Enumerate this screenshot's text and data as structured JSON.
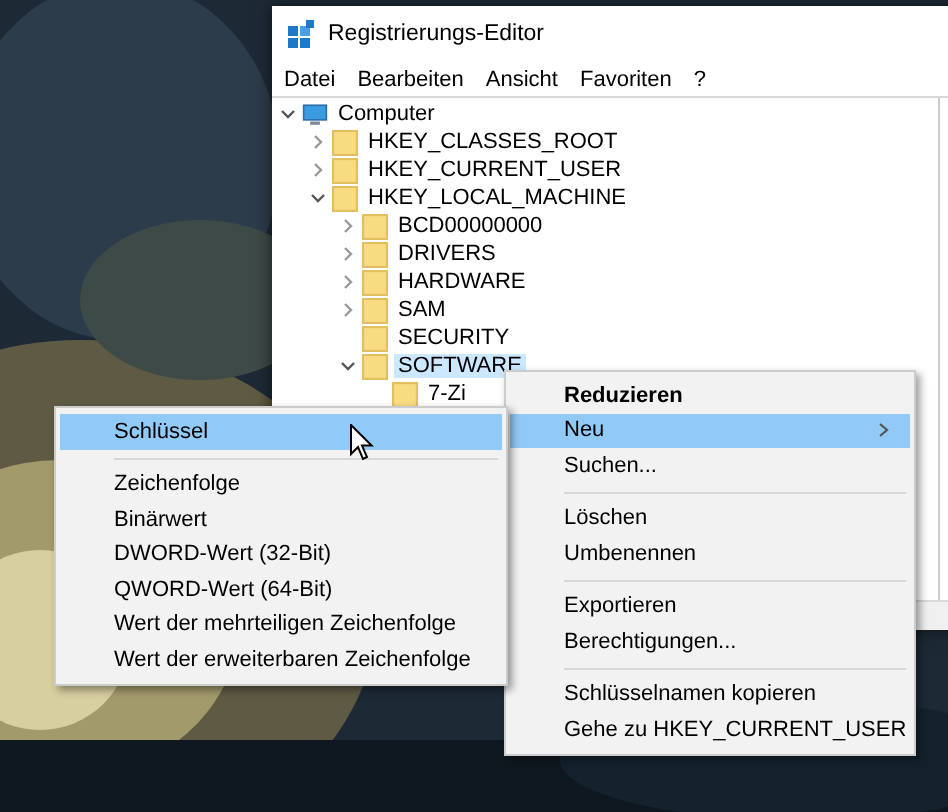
{
  "window": {
    "title": "Registrierungs-Editor"
  },
  "menu_bar": [
    "Datei",
    "Bearbeiten",
    "Ansicht",
    "Favoriten",
    "?"
  ],
  "tree": [
    {
      "label": "Computer",
      "kind": "computer",
      "expanded": true,
      "selected": false,
      "children": [
        {
          "label": "HKEY_CLASSES_ROOT",
          "kind": "folder",
          "expanded": false,
          "selected": false
        },
        {
          "label": "HKEY_CURRENT_USER",
          "kind": "folder",
          "expanded": false,
          "selected": false
        },
        {
          "label": "HKEY_LOCAL_MACHINE",
          "kind": "folder",
          "expanded": true,
          "selected": false,
          "children": [
            {
              "label": "BCD00000000",
              "kind": "folder",
              "expanded": false,
              "selected": false
            },
            {
              "label": "DRIVERS",
              "kind": "folder",
              "expanded": false,
              "selected": false
            },
            {
              "label": "HARDWARE",
              "kind": "folder",
              "expanded": false,
              "selected": false
            },
            {
              "label": "SAM",
              "kind": "folder",
              "expanded": false,
              "selected": false
            },
            {
              "label": "SECURITY",
              "kind": "folder",
              "selected": false
            },
            {
              "label": "SOFTWARE",
              "kind": "folder",
              "expanded": true,
              "selected": true,
              "children": [
                {
                  "label": "7-Zi",
                  "kind": "folder",
                  "selected": false
                }
              ]
            }
          ]
        }
      ]
    }
  ],
  "context_menu": [
    {
      "kind": "item",
      "label": "Reduzieren",
      "bold": true,
      "selected": false
    },
    {
      "kind": "item",
      "label": "Neu",
      "submenu": true,
      "selected": true
    },
    {
      "kind": "item",
      "label": "Suchen...",
      "selected": false
    },
    {
      "kind": "separator"
    },
    {
      "kind": "item",
      "label": "Löschen",
      "selected": false
    },
    {
      "kind": "item",
      "label": "Umbenennen",
      "selected": false
    },
    {
      "kind": "separator"
    },
    {
      "kind": "item",
      "label": "Exportieren",
      "selected": false
    },
    {
      "kind": "item",
      "label": "Berechtigungen...",
      "selected": false
    },
    {
      "kind": "separator"
    },
    {
      "kind": "item",
      "label": "Schlüsselnamen kopieren",
      "selected": false
    },
    {
      "kind": "item",
      "label": "Gehe zu HKEY_CURRENT_USER",
      "selected": false
    }
  ],
  "submenu": [
    {
      "kind": "item",
      "label": "Schlüssel",
      "selected": true
    },
    {
      "kind": "separator"
    },
    {
      "kind": "item",
      "label": "Zeichenfolge",
      "selected": false
    },
    {
      "kind": "item",
      "label": "Binärwert",
      "selected": false
    },
    {
      "kind": "item",
      "label": "DWORD-Wert (32-Bit)",
      "selected": false
    },
    {
      "kind": "item",
      "label": "QWORD-Wert (64-Bit)",
      "selected": false
    },
    {
      "kind": "item",
      "label": "Wert der mehrteiligen Zeichenfolge",
      "selected": false
    },
    {
      "kind": "item",
      "label": "Wert der erweiterbaren Zeichenfolge",
      "selected": false
    }
  ]
}
